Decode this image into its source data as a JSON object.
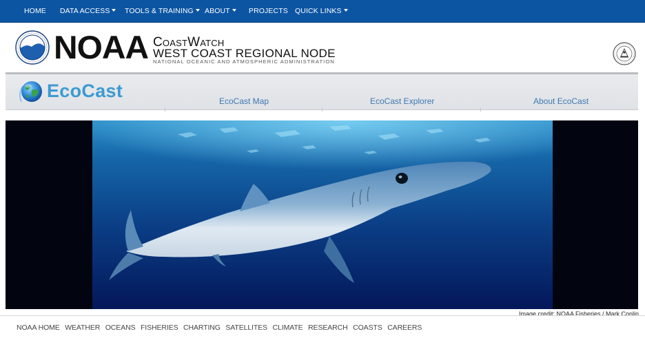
{
  "topnav": {
    "items": [
      {
        "label": "HOME",
        "dropdown": false
      },
      {
        "label": "DATA ACCESS",
        "dropdown": true
      },
      {
        "label": "TOOLS & TRAINING",
        "dropdown": true
      },
      {
        "label": "ABOUT",
        "dropdown": true
      },
      {
        "label": "PROJECTS",
        "dropdown": false
      },
      {
        "label": "QUICK LINKS",
        "dropdown": true
      }
    ]
  },
  "header": {
    "logo_text": "NOAA",
    "line1": "CoastWatch",
    "line2": "WEST COAST REGIONAL NODE",
    "line3": "NATIONAL OCEANIC AND ATMOSPHERIC ADMINISTRATION",
    "logo_icon": "noaa-seal-icon",
    "seal_icon": "department-of-commerce-seal-icon"
  },
  "ecocast": {
    "title": "EcoCast",
    "links": [
      "EcoCast Map",
      "EcoCast Explorer",
      "About EcoCast"
    ],
    "globe_icon": "globe-icon"
  },
  "hero": {
    "image": "blue shark swimming underwater",
    "credit": "Image credit: NOAA Fisheries / Mark Conlin"
  },
  "footer": {
    "links": [
      "NOAA HOME",
      "WEATHER",
      "OCEANS",
      "FISHERIES",
      "CHARTING",
      "SATELLITES",
      "CLIMATE",
      "RESEARCH",
      "COASTS",
      "CAREERS"
    ]
  },
  "colors": {
    "nav_blue": "#0b55a3",
    "ecocast_blue": "#3b9bd1",
    "link_blue": "#3f77b1"
  }
}
